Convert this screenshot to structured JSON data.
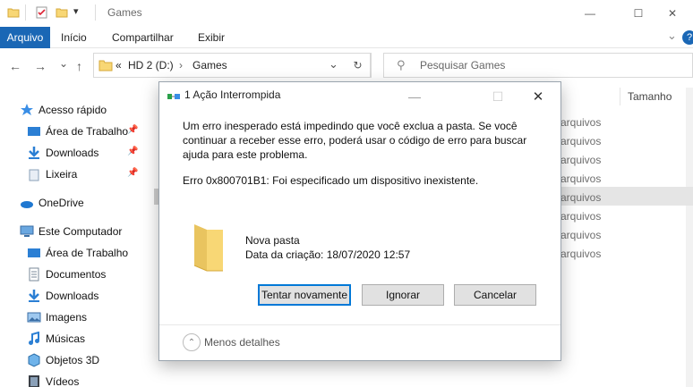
{
  "window": {
    "title": "Games",
    "minimize_glyph": "—",
    "maximize_glyph": "☐",
    "close_glyph": "✕"
  },
  "quick_access_toolbar": {
    "dropdown_glyph": "▾"
  },
  "ribbon": {
    "tabs": [
      "Arquivo",
      "Início",
      "Compartilhar",
      "Exibir"
    ],
    "expand_glyph": "⌄",
    "help_glyph": "?"
  },
  "navigation": {
    "back_glyph": "←",
    "forward_glyph": "→",
    "recent_glyph": "⌄",
    "up_glyph": "↑"
  },
  "address_bar": {
    "overflow": "«",
    "drive": "HD 2 (D:)",
    "separator": "›",
    "folder": "Games",
    "dropdown_glyph": "⌄",
    "refresh_glyph": "↻"
  },
  "search": {
    "icon_glyph": "⚲",
    "placeholder": "Pesquisar Games"
  },
  "nav_pane": {
    "pin_glyph": "📌",
    "quick_access": "Acesso rápido",
    "quick_items": [
      "Área de Trabalho",
      "Downloads",
      "Lixeira"
    ],
    "onedrive": "OneDrive",
    "this_pc": "Este Computador",
    "pc_items": [
      "Área de Trabalho",
      "Documentos",
      "Downloads",
      "Imagens",
      "Músicas",
      "Objetos 3D",
      "Vídeos"
    ]
  },
  "file_list": {
    "size_column": "Tamanho",
    "row_type": "arquivos",
    "row_count_label": "arquivos"
  },
  "dialog": {
    "title": "1 Ação Interrompida",
    "minimize_glyph": "—",
    "maximize_glyph": "☐",
    "close_glyph": "✕",
    "message": "Um erro inesperado está impedindo que você exclua a pasta. Se você continuar a receber esse erro, poderá usar o código de erro para buscar ajuda para este problema.",
    "error": "Erro 0x800701B1: Foi especificado um dispositivo inexistente.",
    "file_name": "Nova pasta",
    "file_date": "Data da criação: 18/07/2020 12:57",
    "retry_button": "Tentar novamente",
    "ignore_button": "Ignorar",
    "cancel_button": "Cancelar",
    "details_glyph": "⌃",
    "details_label": "Menos detalhes"
  },
  "colors": {
    "ribbon_active": "#1a67b5",
    "default_button_border": "#0078d7",
    "folder_yellow": "#f8d775"
  }
}
